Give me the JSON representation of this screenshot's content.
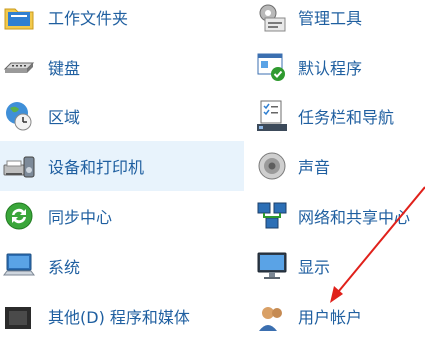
{
  "items_left": [
    {
      "label": "工作文件夹",
      "icon": "work-folders-icon"
    },
    {
      "label": "键盘",
      "icon": "keyboard-icon"
    },
    {
      "label": "区域",
      "icon": "region-globe-clock-icon"
    },
    {
      "label": "设备和打印机",
      "icon": "devices-printers-icon",
      "selected": true
    },
    {
      "label": "同步中心",
      "icon": "sync-center-icon"
    },
    {
      "label": "系统",
      "icon": "system-computer-icon"
    },
    {
      "label": "其他(D) 程序和媒体",
      "icon": "other-media-icon"
    }
  ],
  "items_right": [
    {
      "label": "管理工具",
      "icon": "administrative-tools-icon"
    },
    {
      "label": "默认程序",
      "icon": "default-programs-icon"
    },
    {
      "label": "任务栏和导航",
      "icon": "taskbar-navigation-icon"
    },
    {
      "label": "声音",
      "icon": "speaker-icon"
    },
    {
      "label": "网络和共享中心",
      "icon": "network-sharing-icon"
    },
    {
      "label": "显示",
      "icon": "display-monitor-icon"
    },
    {
      "label": "用户帐户",
      "icon": "user-accounts-icon"
    }
  ],
  "colors": {
    "link_text": "#1f5fa0",
    "selected_background": "#e8f3fc",
    "annotation_arrow": "#e0211b"
  }
}
